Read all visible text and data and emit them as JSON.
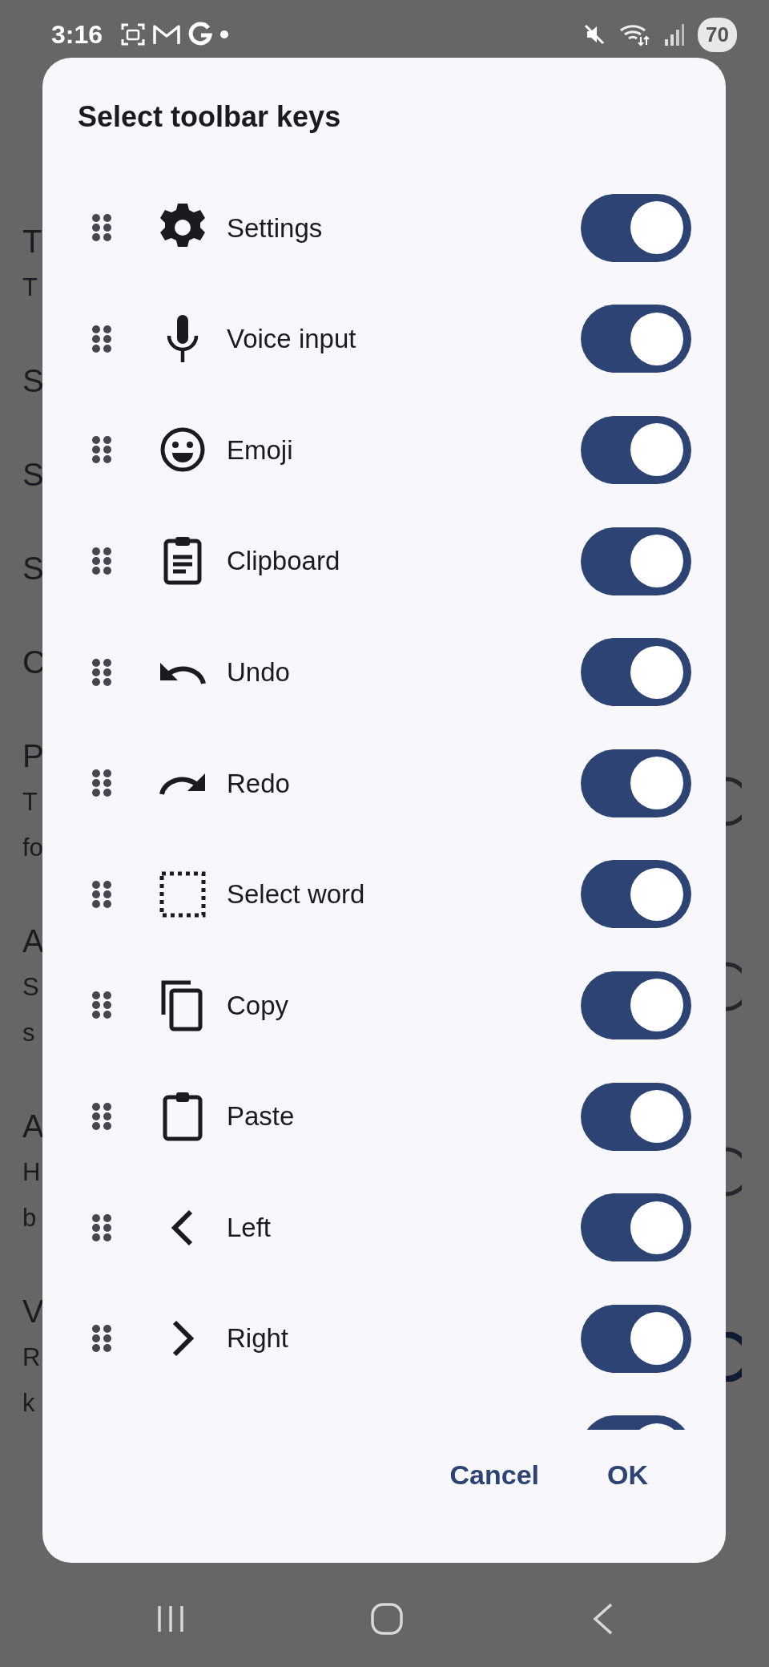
{
  "status_bar": {
    "time": "3:16",
    "battery": "70"
  },
  "background_settings": [
    {
      "title": "T",
      "summary": [
        "T"
      ]
    },
    {
      "title": "S"
    },
    {
      "title": "S"
    },
    {
      "title": "S"
    },
    {
      "title": "C"
    },
    {
      "title": "P",
      "summary": [
        "T",
        "fo"
      ],
      "switch_on": false
    },
    {
      "title": "A",
      "summary": [
        "S",
        "s"
      ],
      "switch_on": false
    },
    {
      "title": "A",
      "summary": [
        "H",
        "b"
      ],
      "switch_on": false
    },
    {
      "title": "V",
      "summary": [
        "R",
        "k"
      ],
      "switch_on": true
    }
  ],
  "dialog": {
    "title": "Select toolbar keys",
    "items": [
      {
        "label": "Settings",
        "on": true
      },
      {
        "label": "Voice input",
        "on": true
      },
      {
        "label": "Emoji",
        "on": true
      },
      {
        "label": "Clipboard",
        "on": true
      },
      {
        "label": "Undo",
        "on": true
      },
      {
        "label": "Redo",
        "on": true
      },
      {
        "label": "Select word",
        "on": true
      },
      {
        "label": "Copy",
        "on": true
      },
      {
        "label": "Paste",
        "on": true
      },
      {
        "label": "Left",
        "on": true
      },
      {
        "label": "Right",
        "on": true
      },
      {
        "on": true
      }
    ],
    "buttons": [
      "Cancel",
      "OK"
    ]
  }
}
